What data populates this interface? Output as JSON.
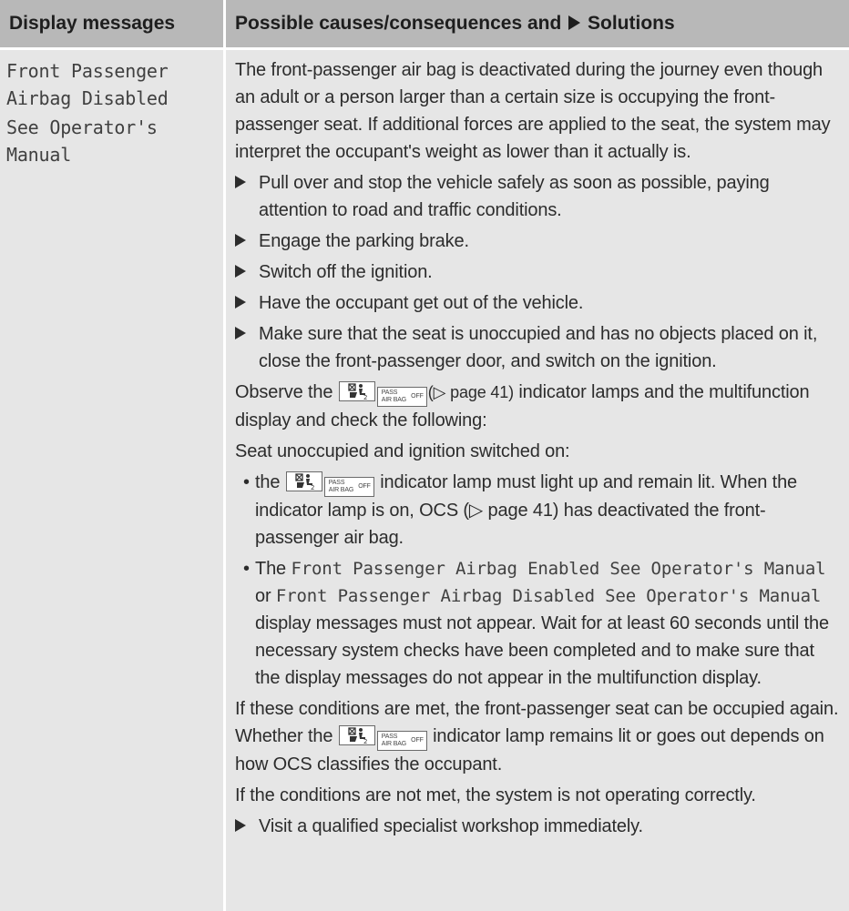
{
  "header": {
    "left": "Display messages",
    "right_prefix": "Possible causes/consequences and",
    "right_suffix": "Solutions"
  },
  "left_column": {
    "line1": "Front Passenger",
    "line2": "Airbag Disabled",
    "line3": "See Operator's",
    "line4": "Manual"
  },
  "content": {
    "intro": "The front-passenger air bag is deactivated during the journey even though an adult or a person larger than a certain size is occupying the front-passenger seat. If additional forces are applied to the seat, the system may interpret the occupant's weight as lower than it actually is.",
    "steps": [
      "Pull over and stop the vehicle safely as soon as possible, paying attention to road and traffic conditions.",
      "Engage the parking brake.",
      "Switch off the ignition.",
      "Have the occupant get out of the vehicle.",
      "Make sure that the seat is unoccupied and has no objects placed on it, close the front-passenger door, and switch on the ignition."
    ],
    "observe_prefix": "Observe the",
    "observe_ref": "(▷ page 41)",
    "observe_suffix": "indicator lamps and the multifunction display and check the following:",
    "seat_line": "Seat unoccupied and ignition switched on:",
    "bullet1_prefix": "the",
    "bullet1_suffix": "indicator lamp must light up and remain lit. When the indicator lamp is on, OCS (▷ page 41) has deactivated the front-passenger air bag.",
    "bullet2_the": "The",
    "bullet2_msg1": "Front Passenger Airbag Enabled See Operator's Manual",
    "bullet2_or": "or",
    "bullet2_msg2": "Front Passenger Airbag Disabled See Operator's Manual",
    "bullet2_suffix": "display messages must not appear. Wait for at least 60 seconds until the necessary system checks have been completed and to make sure that the display messages do not appear in the multifunction display.",
    "met_prefix": "If these conditions are met, the front-passenger seat can be occupied again. Whether the",
    "met_suffix": "indicator lamp remains lit or goes out depends on how OCS classifies the occupant.",
    "not_met": "If the conditions are not met, the system is not operating correctly.",
    "final_step": "Visit a qualified specialist workshop immediately."
  },
  "lamp": {
    "pass_top": "PASS",
    "pass_bottom": "AIR BAG",
    "pass_off": "OFF",
    "seat_icon": "seat-occupant-airbag-off-icon"
  }
}
